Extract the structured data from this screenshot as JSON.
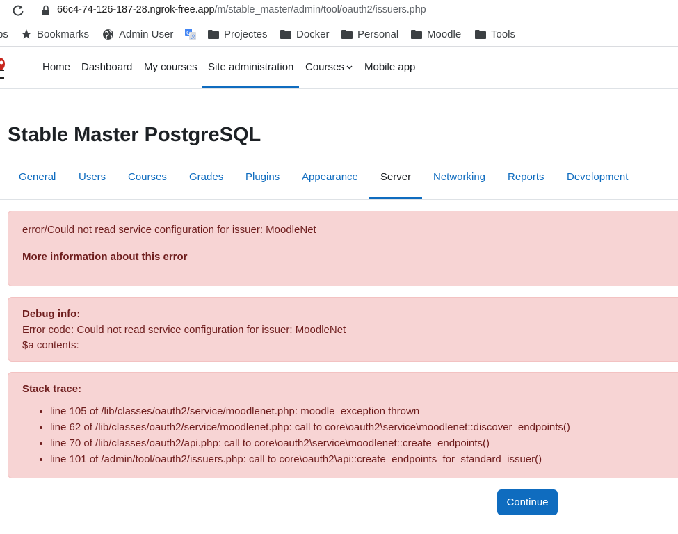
{
  "browser": {
    "url_host": "66c4-74-126-187-28.ngrok-free.app",
    "url_path": "/m/stable_master/admin/tool/oauth2/issuers.php",
    "bookmarks": [
      {
        "label": "ps",
        "icon": "apps-icon"
      },
      {
        "label": "Bookmarks",
        "icon": "star-icon"
      },
      {
        "label": "Admin User",
        "icon": "globe-icon"
      },
      {
        "label": "",
        "icon": "translate-icon"
      },
      {
        "label": "Projectes",
        "icon": "folder-icon"
      },
      {
        "label": "Docker",
        "icon": "folder-icon"
      },
      {
        "label": "Personal",
        "icon": "folder-icon"
      },
      {
        "label": "Moodle",
        "icon": "folder-icon"
      },
      {
        "label": "Tools",
        "icon": "folder-icon"
      }
    ]
  },
  "navbar": {
    "items": [
      "Home",
      "Dashboard",
      "My courses",
      "Site administration",
      "Courses",
      "Mobile app"
    ],
    "active": "Site administration"
  },
  "page": {
    "title": "Stable Master PostgreSQL"
  },
  "tabs": {
    "items": [
      "General",
      "Users",
      "Courses",
      "Grades",
      "Plugins",
      "Appearance",
      "Server",
      "Networking",
      "Reports",
      "Development"
    ],
    "active": "Server"
  },
  "error": {
    "message": "error/Could not read service configuration for issuer: MoodleNet",
    "more_info": "More information about this error"
  },
  "debug": {
    "heading": "Debug info:",
    "error_code": "Error code: Could not read service configuration for issuer: MoodleNet",
    "contents": "$a contents:"
  },
  "stack": {
    "heading": "Stack trace:",
    "lines": [
      "line 105 of /lib/classes/oauth2/service/moodlenet.php: moodle_exception thrown",
      "line 62 of /lib/classes/oauth2/service/moodlenet.php: call to core\\oauth2\\service\\moodlenet::discover_endpoints()",
      "line 70 of /lib/classes/oauth2/api.php: call to core\\oauth2\\service\\moodlenet::create_endpoints()",
      "line 101 of /admin/tool/oauth2/issuers.php: call to core\\oauth2\\api::create_endpoints_for_standard_issuer()"
    ]
  },
  "continue_label": "Continue",
  "colors": {
    "primary": "#0f6cbf",
    "alert_bg": "#f7d4d4",
    "alert_text": "#6e1d1d"
  }
}
